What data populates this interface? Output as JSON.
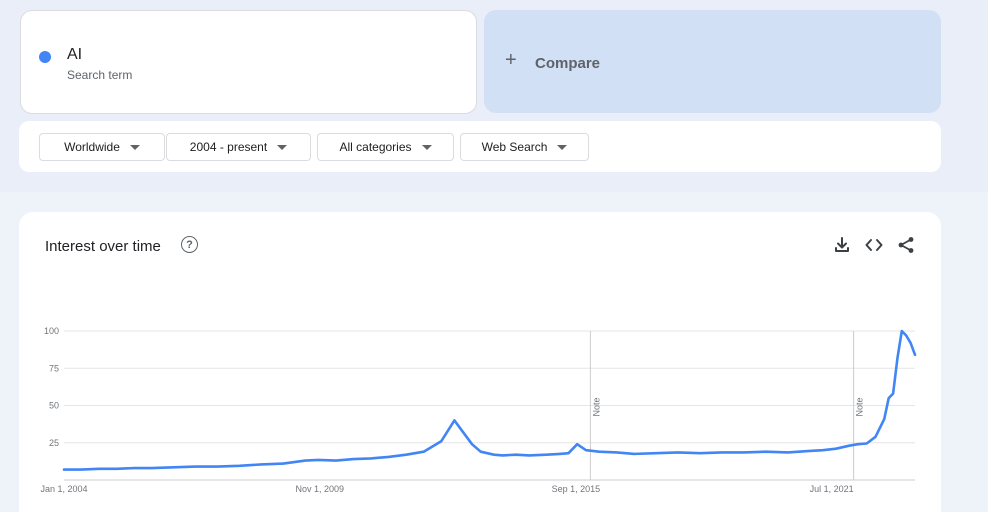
{
  "search_term": {
    "name": "AI",
    "subtitle": "Search term",
    "color": "#4285f4"
  },
  "compare": {
    "plus": "+",
    "label": "Compare"
  },
  "filters": [
    {
      "label": "Worldwide"
    },
    {
      "label": "2004 - present"
    },
    {
      "label": "All categories"
    },
    {
      "label": "Web Search"
    }
  ],
  "chart_card": {
    "title": "Interest over time",
    "help_glyph": "?",
    "actions": [
      "download-icon",
      "embed-icon",
      "share-icon"
    ]
  },
  "chart_data": {
    "type": "line",
    "title": "Interest over time",
    "x_tick_labels": [
      "Jan 1, 2004",
      "Nov 1, 2009",
      "Sep 1, 2015",
      "Jul 1, 2021"
    ],
    "x_ticks_year": [
      2004.0,
      2009.83,
      2015.67,
      2021.5
    ],
    "y_ticks": [
      100,
      75,
      50,
      25
    ],
    "ylim": [
      0,
      100
    ],
    "xlim": [
      2004.0,
      2023.4
    ],
    "grid": true,
    "notes": [
      {
        "label": "Note",
        "x": 2016.0
      },
      {
        "label": "Note",
        "x": 2022.0
      }
    ],
    "series": [
      {
        "color": "#4285f4",
        "x": [
          2004.0,
          2004.4,
          2004.8,
          2005.2,
          2005.6,
          2006.0,
          2006.5,
          2007.0,
          2007.5,
          2008.0,
          2008.5,
          2009.0,
          2009.5,
          2009.8,
          2010.2,
          2010.6,
          2011.0,
          2011.4,
          2011.8,
          2012.2,
          2012.6,
          2012.9,
          2013.1,
          2013.3,
          2013.5,
          2013.8,
          2014.0,
          2014.3,
          2014.6,
          2015.0,
          2015.3,
          2015.5,
          2015.7,
          2015.9,
          2016.2,
          2016.6,
          2017.0,
          2017.5,
          2018.0,
          2018.5,
          2019.0,
          2019.5,
          2020.0,
          2020.5,
          2021.0,
          2021.3,
          2021.6,
          2021.9,
          2022.1,
          2022.3,
          2022.5,
          2022.7,
          2022.8,
          2022.9,
          2023.0,
          2023.1,
          2023.2,
          2023.3,
          2023.4
        ],
        "y": [
          7,
          7,
          7.5,
          7.5,
          8,
          8,
          8.5,
          9,
          9,
          9.5,
          10.5,
          11,
          13,
          13.5,
          13,
          14,
          14.5,
          15.5,
          17,
          19,
          26,
          40,
          32,
          24,
          19,
          17,
          16.5,
          17,
          16.5,
          17,
          17.5,
          18,
          24,
          20,
          19,
          18.5,
          17.5,
          18,
          18.5,
          18,
          18.5,
          18.5,
          19,
          18.5,
          19.5,
          20,
          21,
          23,
          24,
          24.5,
          29,
          41,
          55,
          58,
          82,
          100,
          97,
          92,
          84
        ]
      }
    ]
  }
}
